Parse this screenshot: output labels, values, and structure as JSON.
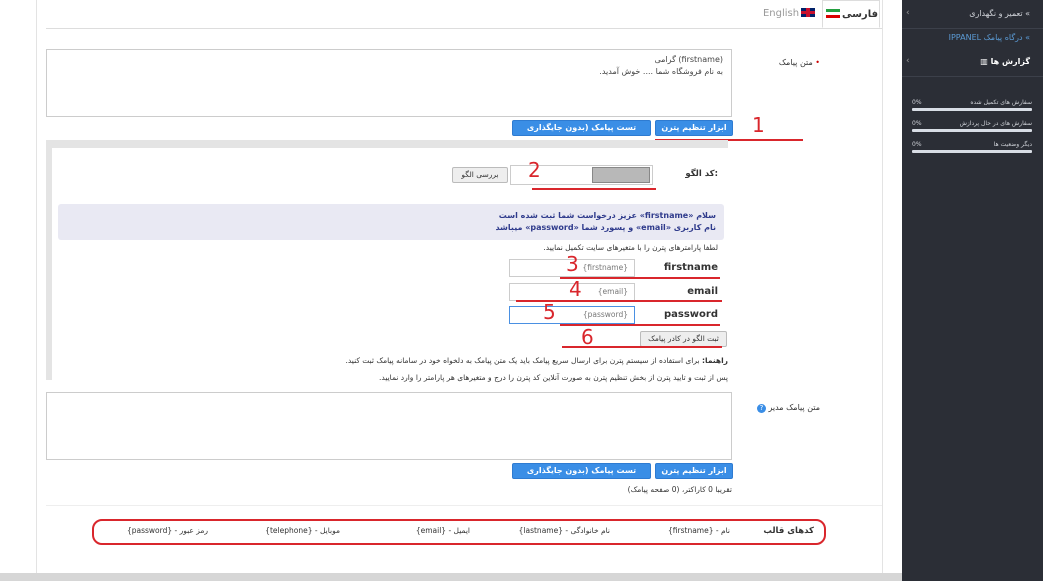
{
  "tabs": {
    "farsi": "فارسی",
    "english": "English"
  },
  "sms_text": {
    "label": "متن پیامک",
    "value": "(firstname) گرامی\nبه نام فروشگاه شما .... خوش آمدید."
  },
  "pattern_tool": {
    "tool_button": "ابزار تنظیم پترن",
    "test_button": "تست پیامک (بدون جایگذاری متغیرها)"
  },
  "pattern": {
    "code_label": "کد الگو:",
    "check_button": "بررسی الگو",
    "message_line1": "سلام «firstname» عزیز درخواست شما ثبت شده است",
    "message_line2": "نام کاربری «email» و پسورد شما «password» میباشد",
    "fill_hint": "لطفا پارامترهای پترن را با متغیرهای سایت تکمیل نمایید.",
    "params": [
      {
        "name": "firstname",
        "value": "{firstname}"
      },
      {
        "name": "email",
        "value": "{email}"
      },
      {
        "name": "password",
        "value": "{password}"
      }
    ],
    "register_button": "ثبت الگو در کادر پیامک",
    "guide_title": "راهنما:",
    "guide_line1": "برای استفاده از سیستم پترن برای ارسال سریع پیامک باید یک متن پیامک به دلخواه خود در سامانه پیامک ثبت کنید.",
    "guide_line2": "پس از ثبت و تایید پترن از بخش تنظیم پترن به صورت آنلاین کد پترن را درج و متغیرهای هر پارامتر را وارد نمایید."
  },
  "admin_sms": {
    "label": "متن پیامک مدیر",
    "value": "",
    "tool_button": "ابزار تنظیم پترن",
    "test_button": "تست پیامک (بدون جایگذاری متغیرها)",
    "char_count": "تقریبا 0 کاراکتر، (0 صفحه پیامک)"
  },
  "template_codes": {
    "label": "کدهای قالب",
    "items": [
      "نام - {firstname}",
      "نام خانوادگی - {lastname}",
      "ایمیل - {email}",
      "موبایل - {telephone}",
      "رمز عبور - {password}"
    ]
  },
  "annotations": [
    "1",
    "2",
    "3",
    "4",
    "5",
    "6"
  ],
  "sidebar": {
    "maintenance": "تعمیر و نگهداری",
    "gateway": "درگاه پیامک IPPANEL",
    "reports": "گزارش ها",
    "stats": [
      {
        "label": "سفارش های تکمیل شده",
        "value": "0%"
      },
      {
        "label": "سفارش های در حال پردازش",
        "value": "0%"
      },
      {
        "label": "دیگر وضعیت ها",
        "value": "0%"
      }
    ]
  },
  "colors": {
    "accent": "#3a8ee6",
    "annotation": "#d9262c",
    "sidebar_bg": "#2b2e36",
    "gateway_link": "#5b9bd5"
  }
}
